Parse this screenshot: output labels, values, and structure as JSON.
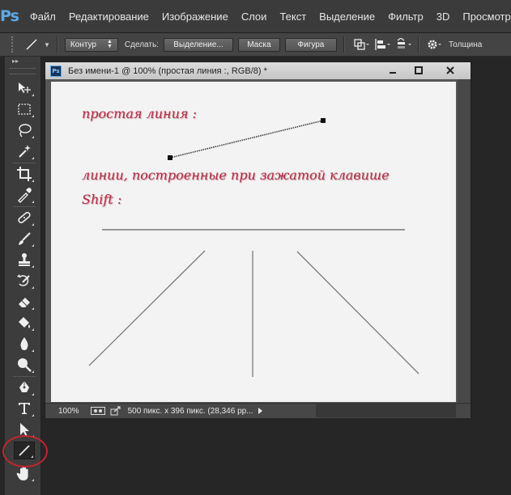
{
  "app": {
    "logo": "Ps"
  },
  "menu": {
    "items": [
      "Файл",
      "Редактирование",
      "Изображение",
      "Слои",
      "Текст",
      "Выделение",
      "Фильтр",
      "3D",
      "Просмотр"
    ]
  },
  "options_bar": {
    "tool_icon": "line-tool-icon",
    "mode_value": "Контур",
    "make_label": "Сделать:",
    "selection_button": "Выделение...",
    "mask_button": "Маска",
    "shape_button": "Фигура",
    "path_ops_icons": [
      "path-operations-icon",
      "path-alignment-icon",
      "path-arrangement-icon"
    ],
    "gear_icon": "gear-icon",
    "weight_label": "Толщина"
  },
  "toolbar": {
    "tools": [
      "move-tool-icon",
      "marquee-tool-icon",
      "lasso-tool-icon",
      "magic-wand-tool-icon",
      "crop-tool-icon",
      "eyedropper-tool-icon",
      "healing-brush-tool-icon",
      "brush-tool-icon",
      "clone-stamp-tool-icon",
      "history-brush-tool-icon",
      "eraser-tool-icon",
      "paint-bucket-tool-icon",
      "blur-tool-icon",
      "dodge-tool-icon",
      "pen-tool-icon",
      "type-tool-icon",
      "path-selection-tool-icon",
      "line-tool-icon",
      "hand-tool-icon"
    ],
    "active_tool": "line-tool-icon",
    "highlight_color": "#c0262d"
  },
  "document": {
    "title": "Без имени-1 @ 100% (простая линия :, RGB/8) *",
    "zoom": "100%",
    "info": "500 пикс. x 396 пикс. (28,346 pp...",
    "canvas": {
      "label1": "простая линия :",
      "label2_line1": "линии, построенные при зажатой клавише",
      "label2_line2": "Shift :",
      "text_color": "#b02a45"
    }
  }
}
